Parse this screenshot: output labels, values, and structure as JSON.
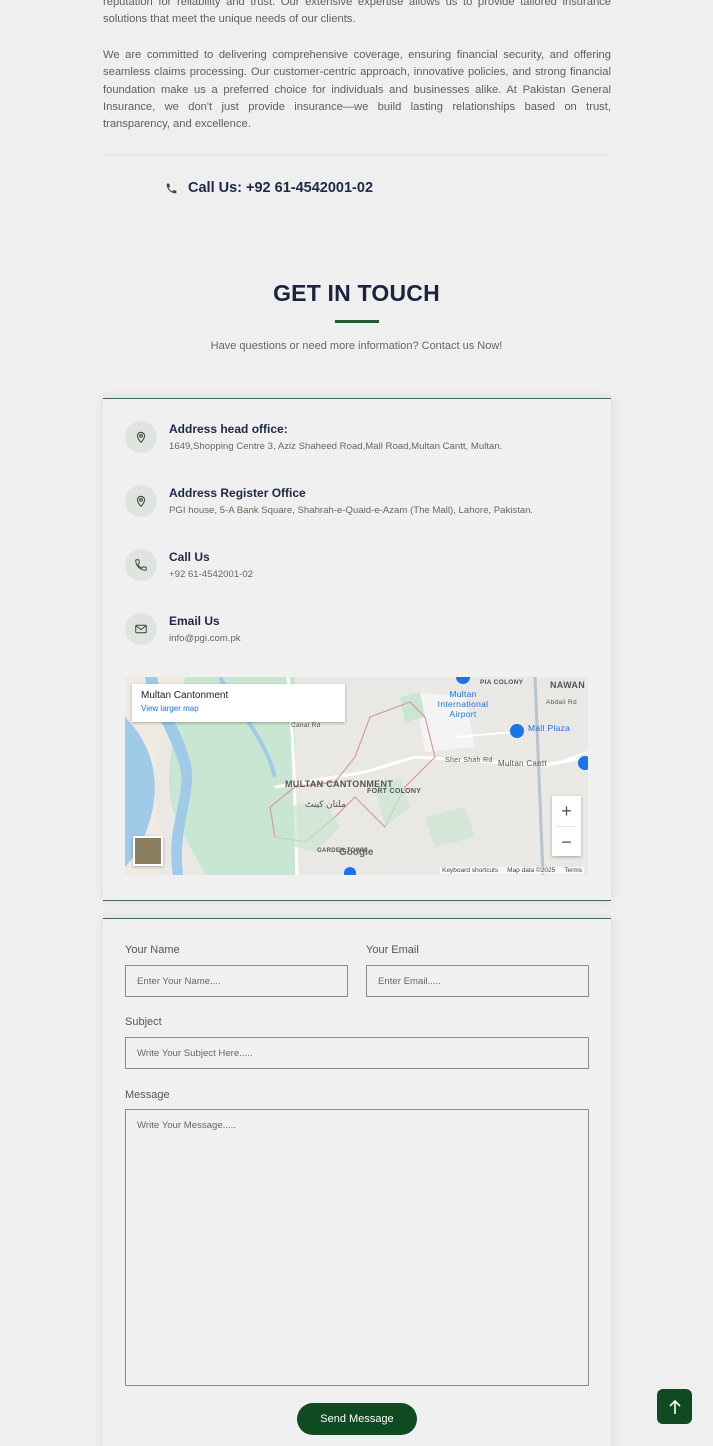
{
  "about": {
    "p1": "reputation for reliability and trust. Our extensive expertise allows us to provide tailored insurance solutions that meet the unique needs of our clients.",
    "p2": "We are committed to delivering comprehensive coverage, ensuring financial security, and offering seamless claims processing. Our customer-centric approach, innovative policies, and strong financial foundation make us a preferred choice for individuals and businesses alike. At Pakistan General Insurance, we don't just provide insurance—we build lasting relationships based on trust, transparency, and excellence."
  },
  "call_top": "Call Us: +92 61-4542001-02",
  "contact": {
    "title": "GET IN TOUCH",
    "subtitle": "Have questions or need more information? Contact us Now!",
    "items": [
      {
        "icon": "location-pin-icon",
        "title": "Address head office:",
        "value": "1649,Shopping Centre 3, Aziz Shaheed Road,Mall Road,Multan Cantt, Multan."
      },
      {
        "icon": "location-pin-icon",
        "title": "Address Register Office",
        "value": "PGI house, 5-A Bank Square, Shahrah-e-Quaid-e-Azam (The Mall), Lahore, Pakistan."
      },
      {
        "icon": "phone-icon",
        "title": "Call Us",
        "value": "+92 61-4542001-02"
      },
      {
        "icon": "envelope-icon",
        "title": "Email Us",
        "value": "info@pgi.com.pk"
      }
    ]
  },
  "map": {
    "place": "Multan Cantonment",
    "link": "View larger map",
    "labels": {
      "cantonment": "MULTAN CANTONMENT",
      "cantonment_urdu": "ملتان کینٹ",
      "fort": "FORT COLONY",
      "pia": "PIA COLONY",
      "nawan": "NAWAN",
      "airport": "Multan International Airport",
      "mall": "Mall Plaza",
      "shershah": "Sher Shah Rd",
      "multancantt": "Multan Cantt",
      "garden": "GARDEN TOWN",
      "canal": "Canal Rd",
      "abdali": "Abdali Rd"
    },
    "zoom_in": "+",
    "zoom_out": "−",
    "google": "Google",
    "keyboard": "Keyboard shortcuts",
    "mapdata": "Map data ©2025",
    "terms": "Terms"
  },
  "form": {
    "name_label": "Your Name",
    "name_placeholder": "Enter Your Name....",
    "email_label": "Your Email",
    "email_placeholder": "Enter Email.....",
    "subject_label": "Subject",
    "subject_placeholder": "Write Your Subject Here.....",
    "message_label": "Message",
    "message_placeholder": "Write Your Message.....",
    "send": "Send Message"
  },
  "colors": {
    "brand_green": "#0f4a20",
    "heading": "#1a2340"
  }
}
